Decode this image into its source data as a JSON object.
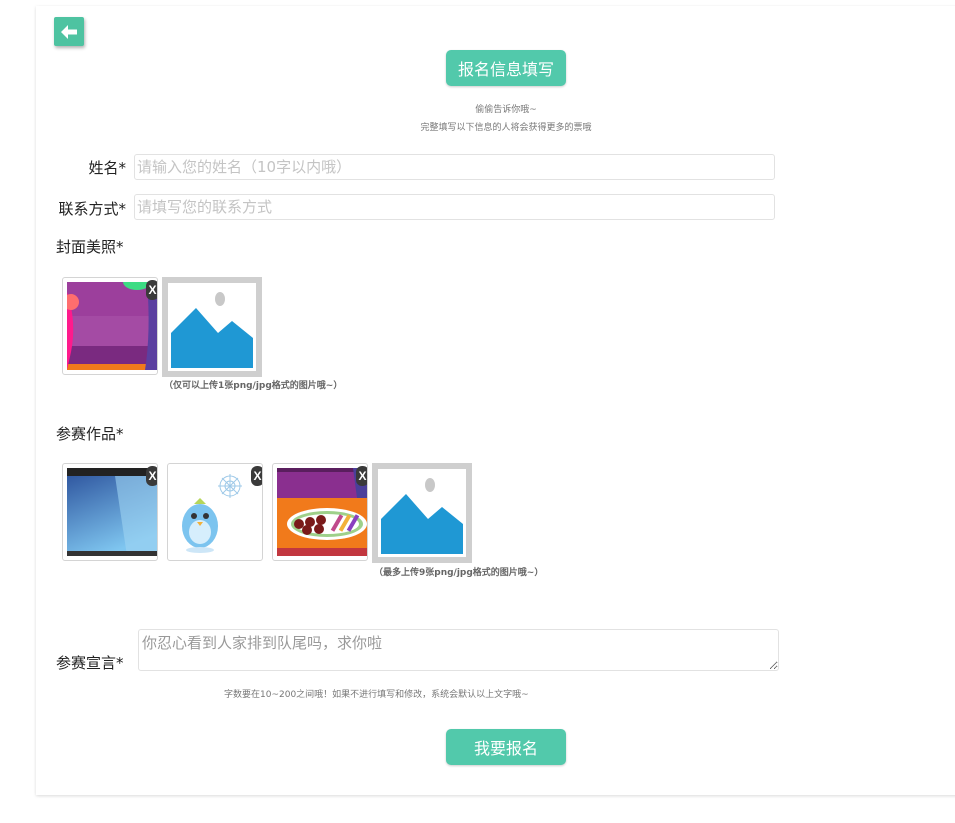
{
  "header": {
    "title": "报名信息填写",
    "back_icon": "arrow-left-icon"
  },
  "intro": {
    "line1": "偷偷告诉你哦~",
    "line2": "完整填写以下信息的人将会获得更多的票哦"
  },
  "form": {
    "name": {
      "label": "姓名*",
      "placeholder": "请输入您的姓名（10字以内哦）",
      "value": ""
    },
    "contact": {
      "label": "联系方式*",
      "placeholder": "请填写您的联系方式",
      "value": ""
    },
    "cover": {
      "label": "封面美照*",
      "delete_label": "X",
      "hint": "（仅可以上传1张png/jpg格式的图片哦~）"
    },
    "works": {
      "label": "参赛作品*",
      "delete_label": "X",
      "hint": "（最多上传9张png/jpg格式的图片哦~）"
    },
    "declaration": {
      "label": "参赛宣言*",
      "value": "你忍心看到人家排到队尾吗，求你啦",
      "hint": "字数要在10~200之间哦！如果不进行填写和修改，系统会默认以上文字哦~"
    },
    "submit_label": "我要报名"
  },
  "colors": {
    "accent": "#52c9ab",
    "back_button": "#4ec3a1"
  }
}
